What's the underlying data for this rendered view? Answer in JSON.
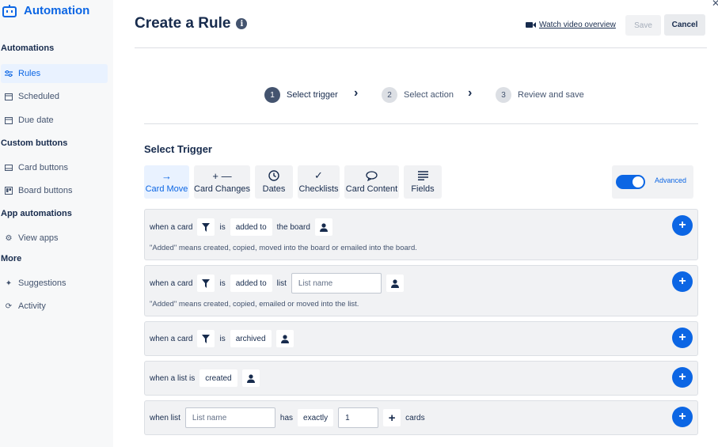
{
  "sidebar": {
    "brand": "Automation",
    "sections": [
      {
        "heading": "Automations",
        "items": [
          {
            "label": "Rules",
            "icon": "sliders-icon",
            "active": true
          },
          {
            "label": "Scheduled",
            "icon": "calendar-icon"
          },
          {
            "label": "Due date",
            "icon": "calendar-icon"
          }
        ]
      },
      {
        "heading": "Custom buttons",
        "items": [
          {
            "label": "Card buttons",
            "icon": "card-icon"
          },
          {
            "label": "Board buttons",
            "icon": "board-icon"
          }
        ]
      },
      {
        "heading": "App automations",
        "items": [
          {
            "label": "View apps",
            "icon": "gear-icon"
          }
        ]
      },
      {
        "heading": "More",
        "items": [
          {
            "label": "Suggestions",
            "icon": "sparkle-icon"
          },
          {
            "label": "Activity",
            "icon": "refresh-icon"
          }
        ]
      }
    ]
  },
  "header": {
    "title": "Create a Rule",
    "watch_label": "Watch video overview",
    "save_label": "Save",
    "cancel_label": "Cancel"
  },
  "steps": [
    {
      "num": "1",
      "label": "Select trigger"
    },
    {
      "num": "2",
      "label": "Select action"
    },
    {
      "num": "3",
      "label": "Review and save"
    }
  ],
  "trigger": {
    "title": "Select Trigger",
    "tabs": [
      {
        "label": "Card Move",
        "icon": "arrow-right-icon"
      },
      {
        "label": "Card Changes",
        "icon": "plus-minus-icon"
      },
      {
        "label": "Dates",
        "icon": "clock-icon"
      },
      {
        "label": "Checklists",
        "icon": "check-icon"
      },
      {
        "label": "Card Content",
        "icon": "comment-icon"
      },
      {
        "label": "Fields",
        "icon": "lines-icon"
      }
    ],
    "advanced_label": "Advanced",
    "rows": [
      {
        "prefix": "when a card",
        "is": "is",
        "action": "added to",
        "target": "the board",
        "note": "\"Added\" means created, copied, moved into the board or emailed into the board."
      },
      {
        "prefix": "when a card",
        "is": "is",
        "action": "added to",
        "target": "list",
        "placeholder": "List name",
        "note": "\"Added\" means created, copied, emailed or moved into the list."
      },
      {
        "prefix": "when a card",
        "is": "is",
        "action": "archived"
      },
      {
        "prefix": "when a list is",
        "action": "created"
      },
      {
        "prefix": "when list",
        "placeholder": "List name",
        "has": "has",
        "qualifier": "exactly",
        "count": "1",
        "suffix": "cards"
      }
    ]
  },
  "colors": {
    "accent": "#0c66e4",
    "active_bg": "#e9f2ff",
    "row_bg": "#f1f2f4"
  }
}
